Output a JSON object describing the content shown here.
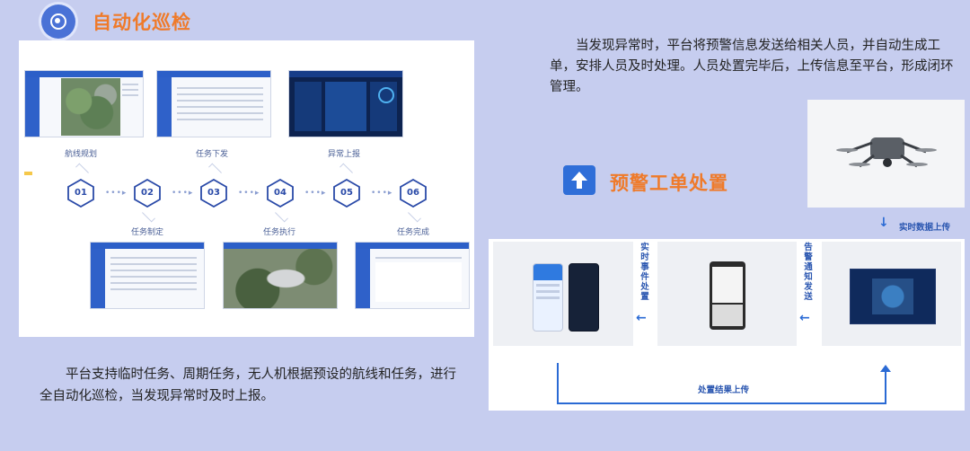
{
  "header": {
    "title": "自动化巡检",
    "icon": "chrome-like-circle-icon"
  },
  "flow": {
    "top_captions": [
      "航线规划",
      "任务下发",
      "异常上报"
    ],
    "bottom_captions": [
      "任务制定",
      "任务执行",
      "任务完成"
    ],
    "steps": [
      "01",
      "02",
      "03",
      "04",
      "05",
      "06"
    ],
    "connector": "•••▸"
  },
  "left_paragraph": "平台支持临时任务、周期任务，无人机根据预设的航线和任务，进行全自动化巡检，当发现异常时及时上报。",
  "right_paragraph": "当发现异常时，平台将预警信息发送给相关人员，并自动生成工单，安排人员及时处理。人员处置完毕后，上传信息至平台，形成闭环管理。",
  "workorder": {
    "title": "预警工单处置",
    "icon": "upload-arrow-icon",
    "realtime_upload": "实时数据上传",
    "realtime_event": "实时事件处置",
    "alert_notify": "告警通知发送",
    "result_upload": "处置结果上传",
    "left_arrow": "←",
    "down_arrow": "↓"
  },
  "colors": {
    "accent": "#ef7a2a",
    "brand": "#2a56b0",
    "bg": "#c6cdef"
  }
}
